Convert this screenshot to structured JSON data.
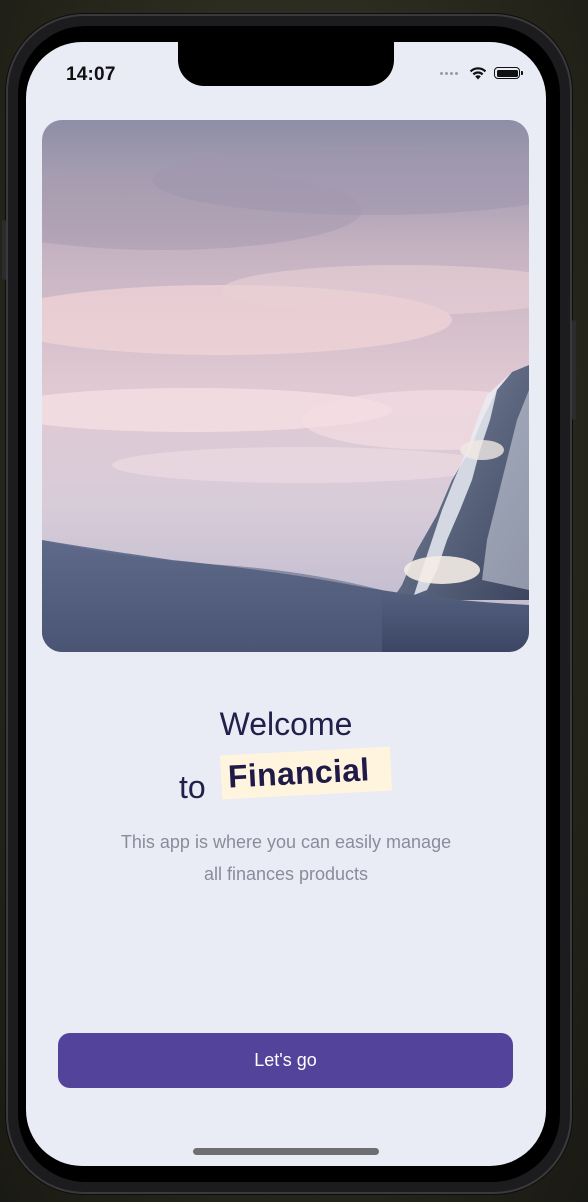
{
  "status_bar": {
    "time": "14:07",
    "icons": [
      "signal-dots-icon",
      "wifi-icon",
      "battery-icon"
    ]
  },
  "hero": {
    "image": "mountain-sky-photo"
  },
  "welcome": {
    "line1": "Welcome",
    "line2_prefix": "to",
    "brand": "Financial"
  },
  "subtitle": {
    "line1": "This app is where you can easily manage",
    "line2": "all finances products"
  },
  "cta": {
    "label": "Let's go"
  },
  "colors": {
    "background": "#e9ecf5",
    "primary": "#53439a",
    "heading": "#22204a",
    "highlight": "#fff4dd",
    "muted_text": "#8a8c9c"
  }
}
